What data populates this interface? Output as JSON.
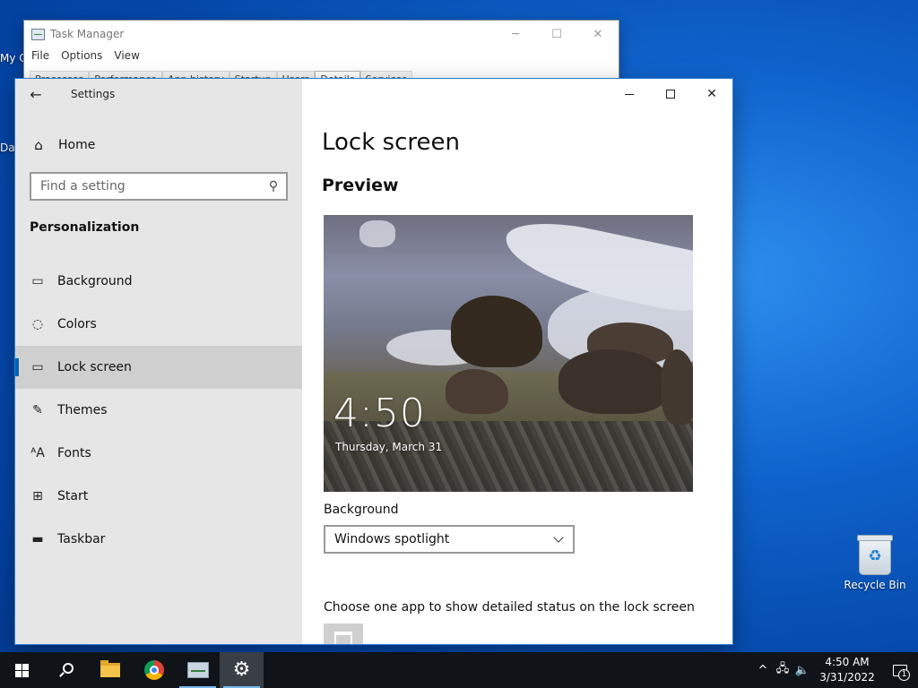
{
  "desktop": {
    "partial_icon_1": "My C",
    "partial_icon_2": "Da",
    "recycle_bin_label": "Recycle Bin"
  },
  "task_manager": {
    "title": "Task Manager",
    "menu": [
      "File",
      "Options",
      "View"
    ],
    "tabs": [
      "Processes",
      "Performance",
      "App history",
      "Startup",
      "Users",
      "Details",
      "Services"
    ],
    "active_tab": "Details"
  },
  "settings": {
    "window_title": "Settings",
    "home_label": "Home",
    "search_placeholder": "Find a setting",
    "section": "Personalization",
    "nav": [
      {
        "label": "Background",
        "icon": "picture-icon"
      },
      {
        "label": "Colors",
        "icon": "palette-icon"
      },
      {
        "label": "Lock screen",
        "icon": "lock-screen-icon",
        "selected": true
      },
      {
        "label": "Themes",
        "icon": "brush-icon"
      },
      {
        "label": "Fonts",
        "icon": "fonts-icon"
      },
      {
        "label": "Start",
        "icon": "start-icon"
      },
      {
        "label": "Taskbar",
        "icon": "taskbar-icon"
      }
    ],
    "page_title": "Lock screen",
    "preview_heading": "Preview",
    "preview_time": "4:50",
    "preview_date": "Thursday, March 31",
    "background_label": "Background",
    "background_value": "Windows spotlight",
    "status_label": "Choose one app to show detailed status on the lock screen",
    "accent_color": "#0063b1"
  },
  "taskbar": {
    "clock_time": "4:50 AM",
    "clock_date": "3/31/2022",
    "notification_count": "1"
  }
}
